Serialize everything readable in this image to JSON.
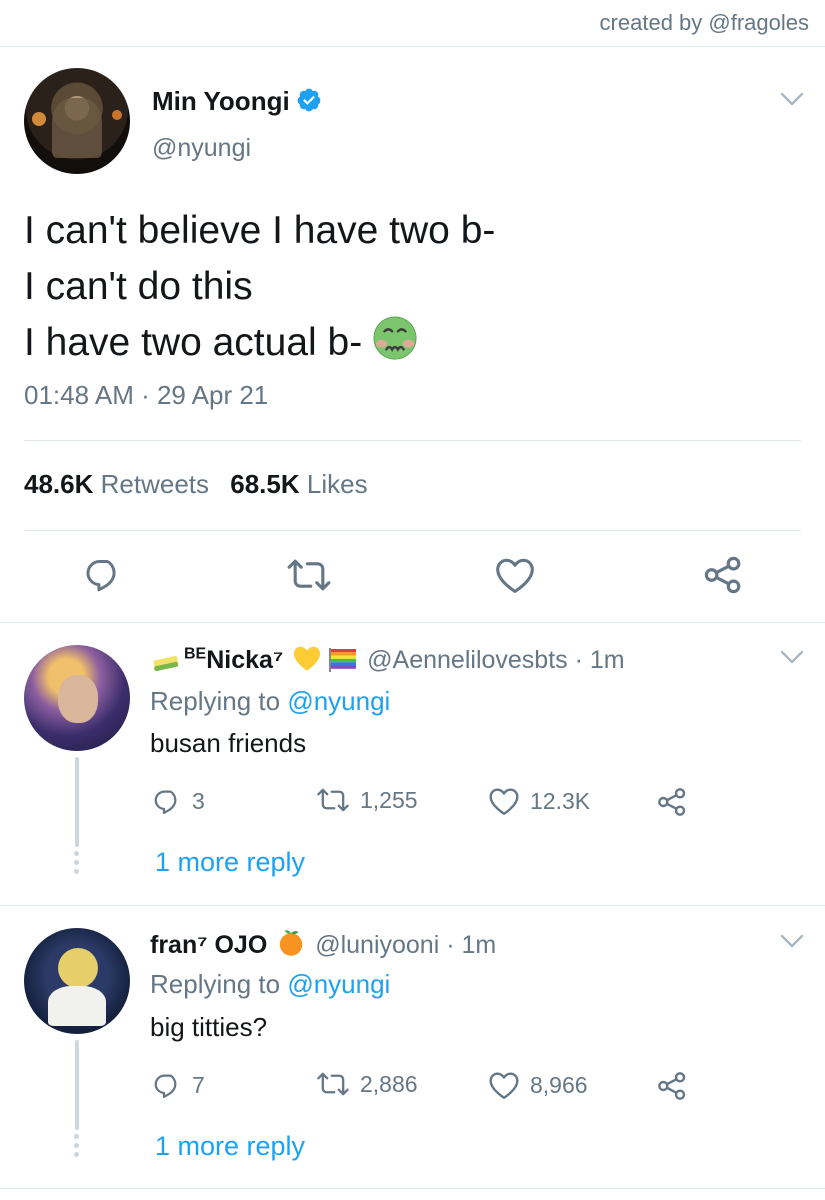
{
  "credit": "created by @fragoles",
  "tweet": {
    "name": "Min Yoongi",
    "handle": "@nyungi",
    "lines": [
      "I can't believe I have two b-",
      "I can't do this",
      "I have two actual b-"
    ],
    "timestamp": "01:48 AM · 29 Apr 21",
    "retweets_count": "48.6K",
    "retweets_label": "Retweets",
    "likes_count": "68.5K",
    "likes_label": "Likes"
  },
  "replies": [
    {
      "name_prefix": "BE",
      "name": "Nicka⁷",
      "handle": "@Aennelilovesbts",
      "time": "· 1m",
      "replying_label": "Replying to",
      "replying_to": "@nyungi",
      "text": "busan friends",
      "reply_count": "3",
      "retweet_count": "1,255",
      "like_count": "12.3K",
      "more_replies": "1 more reply"
    },
    {
      "name": "fran⁷ OJO",
      "handle": "@luniyooni",
      "time": "· 1m",
      "replying_label": "Replying to",
      "replying_to": "@nyungi",
      "text": "big titties?",
      "reply_count": "7",
      "retweet_count": "2,886",
      "like_count": "8,966",
      "more_replies": "1 more reply"
    }
  ],
  "colors": {
    "accent": "#1da1f2",
    "muted": "#657786",
    "divider": "#e1e8ed",
    "text": "#14171a"
  },
  "icons": [
    "verified-badge-icon",
    "chevron-down-icon",
    "reply-icon",
    "retweet-icon",
    "like-icon",
    "share-icon",
    "nauseated-face-emoji",
    "sponge-emoji",
    "yellow-heart-emoji",
    "rainbow-flag-emoji",
    "tangerine-emoji"
  ]
}
